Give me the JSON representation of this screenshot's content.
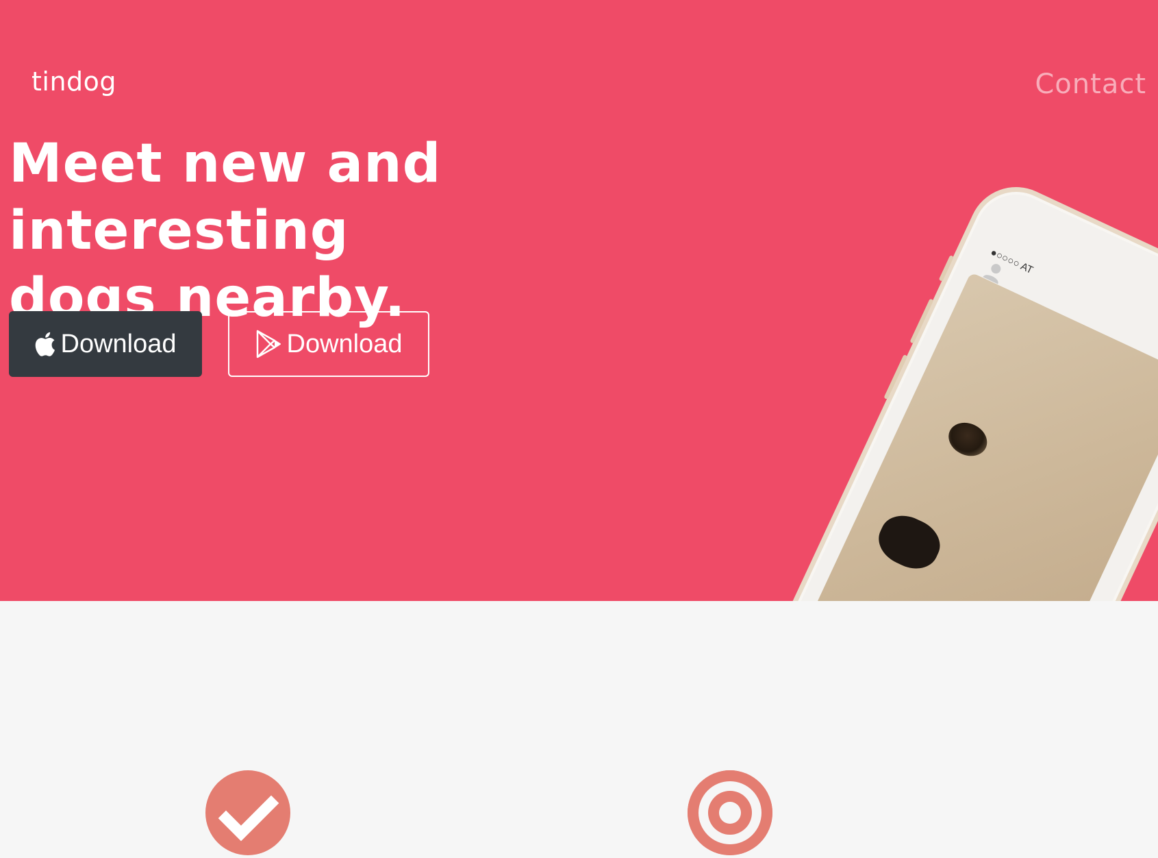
{
  "navbar": {
    "brand": "tindog",
    "contact_label": "Contact"
  },
  "hero": {
    "headline_line1": "Meet new and interesting",
    "headline_line2": "dogs nearby.",
    "buttons": [
      {
        "label": "Download",
        "icon": "apple-icon"
      },
      {
        "label": "Download",
        "icon": "google-play-icon"
      }
    ]
  },
  "phone": {
    "status": "●○○○○ AT"
  },
  "features": {
    "icons": [
      "check-circle-icon",
      "bullseye-icon"
    ]
  },
  "colors": {
    "hero_bg": "#ef4b67",
    "dark_button": "#343a40",
    "feature_icon": "#e47d71",
    "page_bg": "#f6f6f6"
  }
}
